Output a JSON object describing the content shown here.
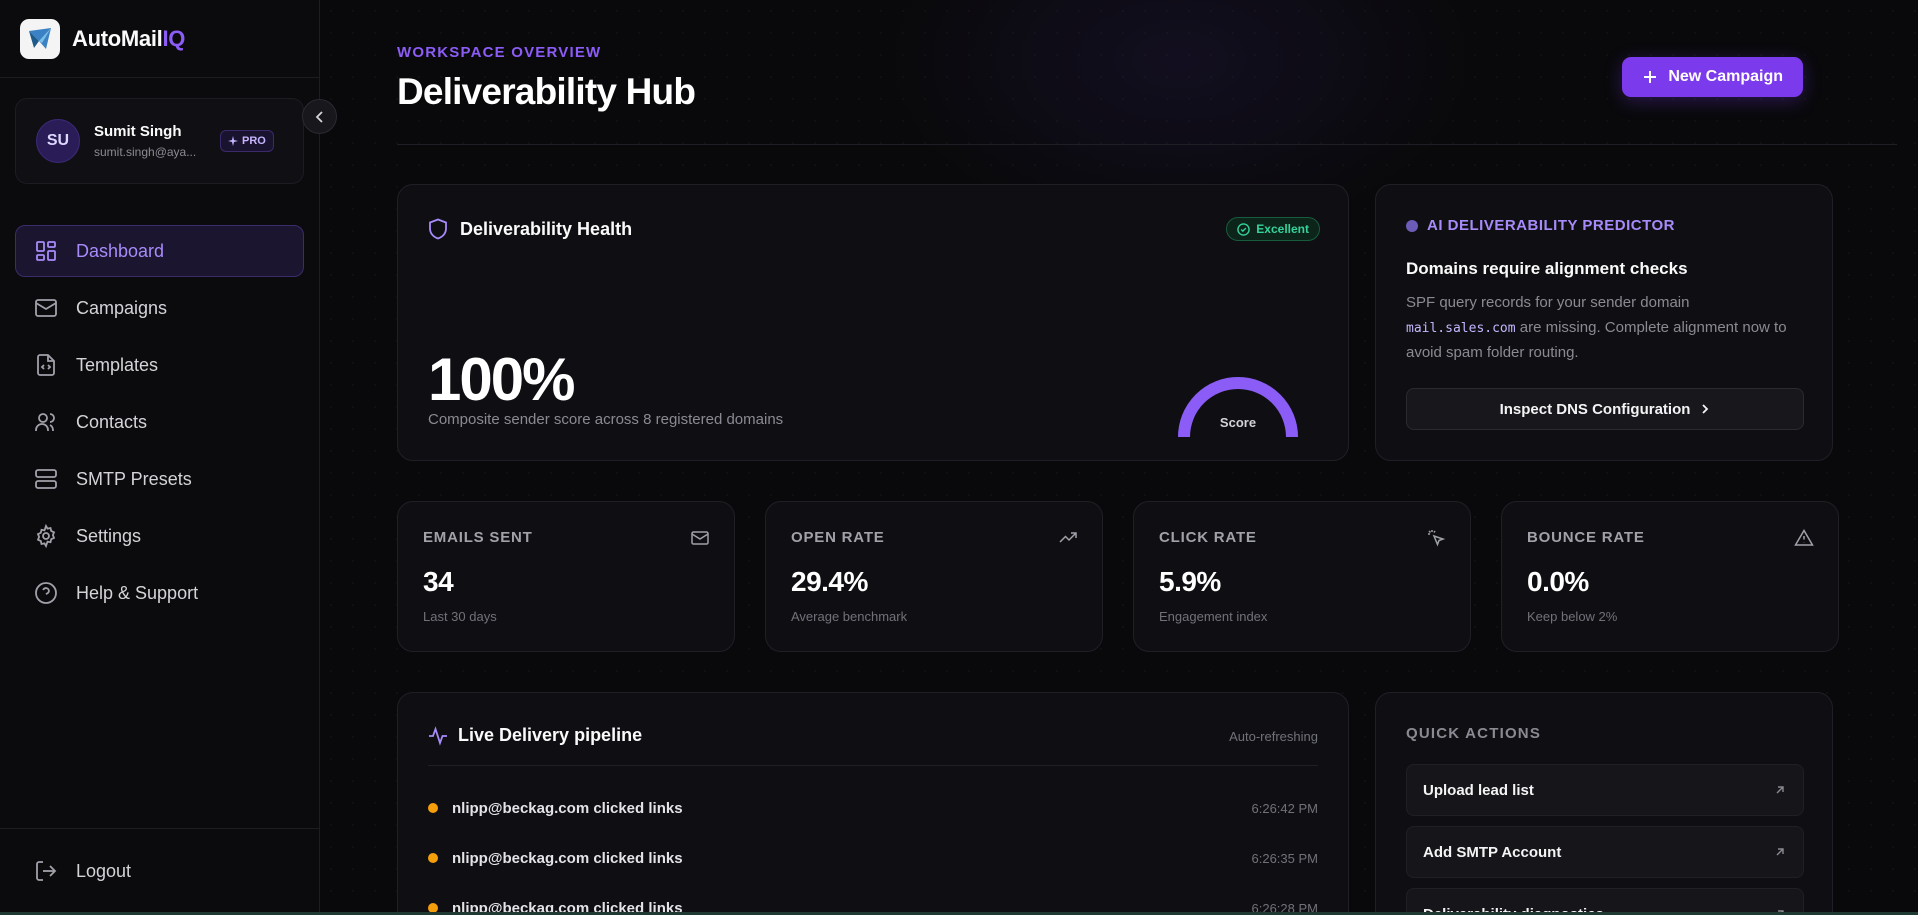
{
  "brand": {
    "name_main": "AutoMail",
    "name_accent": "IQ"
  },
  "user": {
    "initials": "SU",
    "name": "Sumit Singh",
    "email": "sumit.singh@aya...",
    "badge": "PRO"
  },
  "nav": {
    "items": [
      {
        "label": "Dashboard",
        "icon": "dashboard-icon",
        "active": true
      },
      {
        "label": "Campaigns",
        "icon": "mail-icon"
      },
      {
        "label": "Templates",
        "icon": "file-code-icon"
      },
      {
        "label": "Contacts",
        "icon": "users-icon"
      },
      {
        "label": "SMTP Presets",
        "icon": "server-icon"
      },
      {
        "label": "Settings",
        "icon": "gear-icon"
      },
      {
        "label": "Help & Support",
        "icon": "help-circle-icon"
      }
    ],
    "logout": "Logout"
  },
  "header": {
    "eyebrow": "WORKSPACE OVERVIEW",
    "title": "Deliverability Hub",
    "new_campaign": "New Campaign"
  },
  "health": {
    "title": "Deliverability Health",
    "status": "Excellent",
    "score": "100%",
    "score_value": 100,
    "subtitle": "Composite sender score across 8 registered domains",
    "gauge_label": "Score"
  },
  "ai": {
    "label": "AI DELIVERABILITY PREDICTOR",
    "title": "Domains require alignment checks",
    "body_before": "SPF query records for your sender domain",
    "domain": "mail.sales.com",
    "body_after": "are missing. Complete alignment now to avoid spam folder routing.",
    "button": "Inspect DNS Configuration"
  },
  "stats": [
    {
      "label": "EMAILS SENT",
      "value": "34",
      "sub": "Last 30 days",
      "icon": "mail-icon"
    },
    {
      "label": "OPEN RATE",
      "value": "29.4%",
      "sub": "Average benchmark",
      "icon": "trending-up-icon"
    },
    {
      "label": "CLICK RATE",
      "value": "5.9%",
      "sub": "Engagement index",
      "icon": "pointer-click-icon"
    },
    {
      "label": "BOUNCE RATE",
      "value": "0.0%",
      "sub": "Keep below 2%",
      "icon": "alert-triangle-icon"
    }
  ],
  "pipeline": {
    "title": "Live Delivery pipeline",
    "status": "Auto-refreshing",
    "events": [
      {
        "text": "nlipp@beckag.com clicked links",
        "time": "6:26:42 PM"
      },
      {
        "text": "nlipp@beckag.com clicked links",
        "time": "6:26:35 PM"
      },
      {
        "text": "nlipp@beckag.com clicked links",
        "time": "6:26:28 PM"
      }
    ]
  },
  "quick_actions": {
    "label": "QUICK ACTIONS",
    "items": [
      {
        "label": "Upload lead list"
      },
      {
        "label": "Add SMTP Account"
      },
      {
        "label": "Deliverability diagnostics"
      }
    ]
  },
  "colors": {
    "accent": "#7c3aed",
    "accent_text": "#a78bfa",
    "success": "#34d399",
    "warning": "#f59e0b",
    "background": "#09090b"
  }
}
